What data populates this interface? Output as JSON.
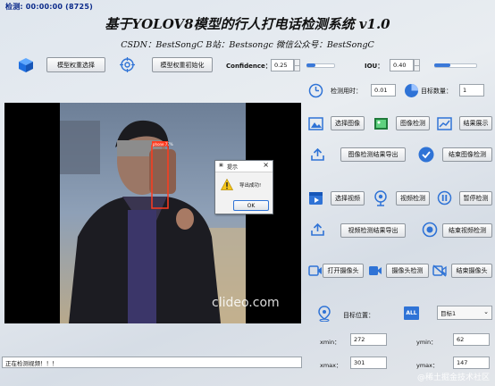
{
  "window": {
    "title": "检测: 00:00:00 (8725)"
  },
  "header": {
    "title": "基于YOLOV8模型的行人打电话检测系统 v1.0",
    "subtitle": "CSDN：BestSongC   B站：Bestsongc   微信公众号：BestSongC"
  },
  "toolbar": {
    "model_select_label": "模型权重选择",
    "model_init_label": "模型权重初始化",
    "confidence_label": "Confidence：",
    "confidence_value": "0.25",
    "iou_label": "IOU：",
    "iou_value": "0.40"
  },
  "stats": {
    "time_label": "检测用时：",
    "time_value": "0.01",
    "count_label": "目标数量：",
    "count_value": "1"
  },
  "image_panel": {
    "select_label": "选择图像",
    "detect_label": "图像检测",
    "show_label": "结果展示",
    "export_label": "图像检测结果导出",
    "end_label": "结束图像检测"
  },
  "video_panel": {
    "select_label": "选择视频",
    "detect_label": "视频检测",
    "pause_label": "暂停检测",
    "export_label": "视频检测结果导出",
    "end_label": "结束视频检测"
  },
  "camera_panel": {
    "open_label": "打开摄像头",
    "detect_label": "摄像头检测",
    "end_label": "结束摄像头"
  },
  "target": {
    "position_label": "目标位置：",
    "all_badge": "ALL",
    "selected": "目标1",
    "xmin_label": "xmin：",
    "xmin_value": "272",
    "ymin_label": "ymin：",
    "ymin_value": "62",
    "xmax_label": "xmax：",
    "xmax_value": "301",
    "ymax_label": "ymax：",
    "ymax_value": "147"
  },
  "detection": {
    "label": "phone 77%"
  },
  "video_watermark": "clideo.com",
  "status": {
    "text": "正在检测视频！！！"
  },
  "dialog": {
    "title": "提示",
    "message": "导出成功!",
    "ok_label": "OK"
  },
  "corner_watermark": "@稀土掘金技术社区",
  "colors": {
    "accent_blue": "#2f73d6",
    "detect_box": "#ff3b1f",
    "title_bar_text": "#0b2a8a"
  },
  "icons": [
    "cube-icon",
    "target-icon",
    "clock-icon",
    "pie-icon",
    "image-icon",
    "gallery-icon",
    "chart-icon",
    "upload-icon",
    "check-icon",
    "video-file-icon",
    "camera-lens-icon",
    "pause-icon",
    "record-icon",
    "camera-icon",
    "camera-off-icon",
    "location-icon",
    "all-icon",
    "warning-icon",
    "close-icon"
  ]
}
